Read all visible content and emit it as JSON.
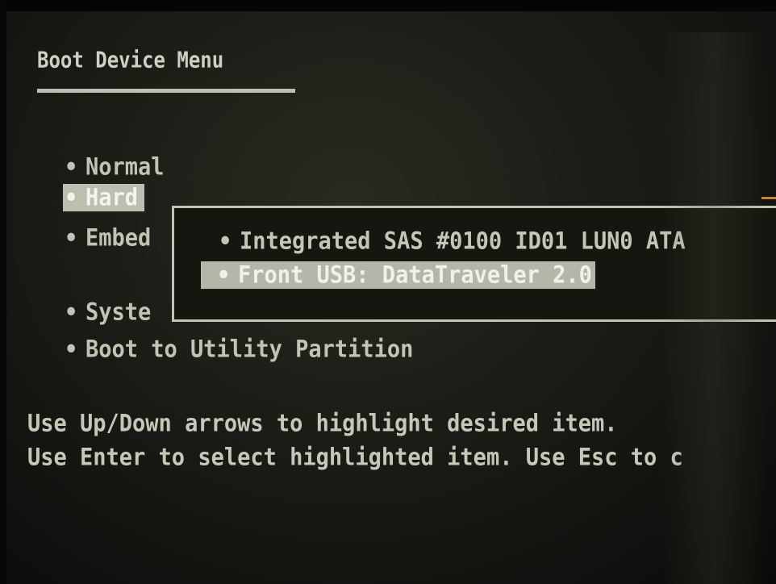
{
  "menu": {
    "title": "Boot Device Menu",
    "bullet": "•",
    "items": [
      {
        "label": "Normal"
      },
      {
        "label": "Hard"
      },
      {
        "label": "Embed"
      },
      {
        "label": "Syste"
      },
      {
        "label": "Boot to Utility Partition"
      }
    ],
    "highlighted_item": "Hard"
  },
  "submenu": {
    "items": [
      {
        "label": "Integrated SAS #0100 ID01 LUN0 ATA"
      },
      {
        "label": "Front USB:  DataTraveler 2.0"
      }
    ],
    "highlighted_item": "Front USB:  DataTraveler 2.0"
  },
  "help": {
    "line1": "Use Up/Down arrows to highlight desired item.",
    "line2": "Use Enter to select highlighted item. Use Esc to c"
  },
  "colors": {
    "background": "#1c1d17",
    "text": "#c9c9bd",
    "highlight": "#bdbdb0"
  }
}
